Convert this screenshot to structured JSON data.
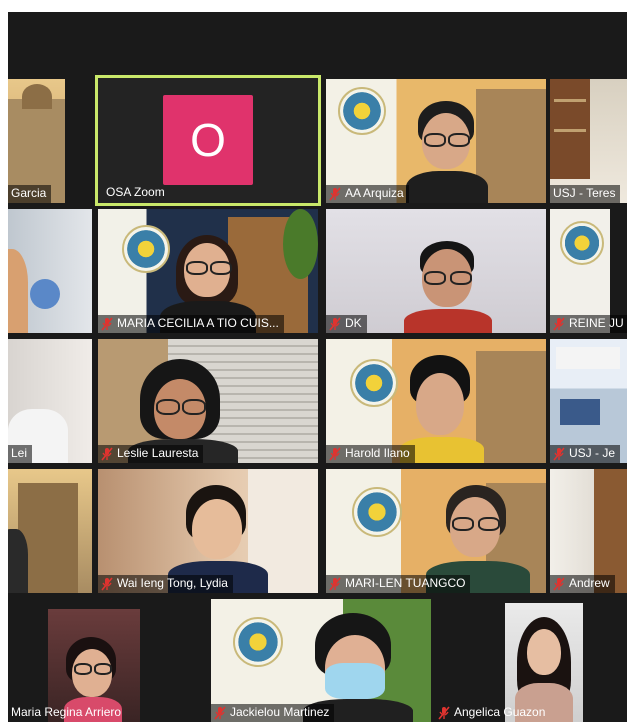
{
  "participants": [
    {
      "name": "Garcia",
      "muted": false
    },
    {
      "name": "OSA Zoom",
      "muted": false,
      "avatar_letter": "O",
      "avatar_color": "#e0336c",
      "active_speaker": true
    },
    {
      "name": "AA Arquiza",
      "muted": true
    },
    {
      "name": "USJ - Teres",
      "muted": false
    },
    {
      "name": "",
      "muted": false
    },
    {
      "name": "MARIA CECILIA A TIO CUIS...",
      "muted": true
    },
    {
      "name": "DK",
      "muted": true
    },
    {
      "name": "REINE JU",
      "muted": true
    },
    {
      "name": "Lei",
      "muted": false
    },
    {
      "name": "Leslie Lauresta",
      "muted": true
    },
    {
      "name": "Harold Ilano",
      "muted": true
    },
    {
      "name": "USJ - Je",
      "muted": true
    },
    {
      "name": "",
      "muted": false
    },
    {
      "name": "Wai Ieng Tong, Lydia",
      "muted": true
    },
    {
      "name": "MARI-LEN TUANGCO",
      "muted": true
    },
    {
      "name": "Andrew",
      "muted": true
    },
    {
      "name": "Maria Regina Arriero",
      "muted": false
    },
    {
      "name": "Jackielou Martinez",
      "muted": true
    },
    {
      "name": "Angelica Guazon",
      "muted": true
    }
  ],
  "colors": {
    "background": "#1a1a1a",
    "active_speaker_border": "#c9e86a",
    "muted_icon": "#e0332f"
  },
  "icons": {
    "muted": "microphone-muted-icon"
  }
}
